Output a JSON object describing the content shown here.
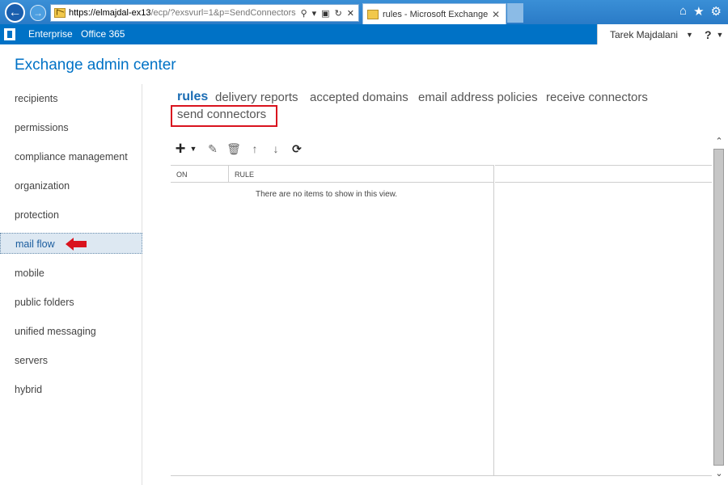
{
  "browser": {
    "url_strong": "https://elmajdal-ex13",
    "url_rest": "/ecp/?exsvurl=1&p=SendConnectors",
    "tab_title": "rules - Microsoft Exchange",
    "back_icon": "back-arrow-icon",
    "forward_icon": "forward-arrow-icon"
  },
  "suitebar": {
    "links": [
      "Enterprise",
      "Office 365"
    ],
    "user": "Tarek Majdalani",
    "help": "?"
  },
  "app": {
    "title": "Exchange admin center"
  },
  "nav": {
    "items": [
      {
        "label": "recipients"
      },
      {
        "label": "permissions"
      },
      {
        "label": "compliance management"
      },
      {
        "label": "organization"
      },
      {
        "label": "protection"
      },
      {
        "label": "mail flow",
        "active": true
      },
      {
        "label": "mobile"
      },
      {
        "label": "public folders"
      },
      {
        "label": "unified messaging"
      },
      {
        "label": "servers"
      },
      {
        "label": "hybrid"
      }
    ]
  },
  "subtabs": {
    "items": [
      {
        "label": "rules",
        "active": true
      },
      {
        "label": "delivery reports"
      },
      {
        "label": "accepted domains"
      },
      {
        "label": "email address policies"
      },
      {
        "label": "receive connectors"
      },
      {
        "label": "send connectors"
      }
    ]
  },
  "toolbar": {
    "icons": [
      "add-icon",
      "edit-icon",
      "delete-icon",
      "move-up-icon",
      "move-down-icon",
      "refresh-icon"
    ]
  },
  "list": {
    "columns": [
      "ON",
      "RULE"
    ],
    "empty_message": "There are no items to show in this view."
  },
  "colors": {
    "brand": "#0072c6",
    "highlight": "#d9131e",
    "active_nav_bg": "#dde8f2"
  }
}
